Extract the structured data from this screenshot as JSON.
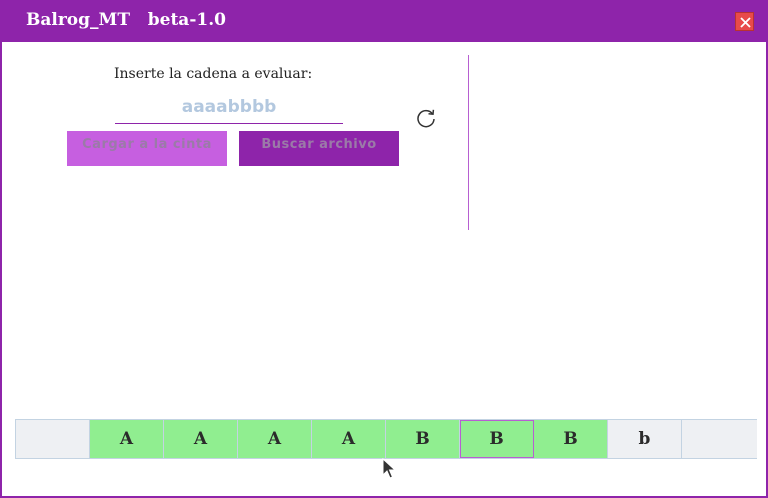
{
  "window": {
    "title": "Balrog_MT   beta-1.0",
    "accent_color": "#8e24aa",
    "close_icon": "close-icon"
  },
  "input_panel": {
    "prompt": "Inserte la cadena a evaluar:",
    "input_value": "aaaabbbb",
    "reload_icon": "reload-icon",
    "load_button_label": "Cargar a la cinta",
    "browse_button_label": "Buscar archivo"
  },
  "tape": {
    "cells": [
      {
        "symbol": "",
        "state": "blank"
      },
      {
        "symbol": "A",
        "state": "processed"
      },
      {
        "symbol": "A",
        "state": "processed"
      },
      {
        "symbol": "A",
        "state": "processed"
      },
      {
        "symbol": "A",
        "state": "processed"
      },
      {
        "symbol": "B",
        "state": "processed"
      },
      {
        "symbol": "B",
        "state": "processed",
        "head": true
      },
      {
        "symbol": "B",
        "state": "processed"
      },
      {
        "symbol": "b",
        "state": "pending"
      },
      {
        "symbol": "",
        "state": "blank"
      }
    ],
    "processed_color": "#90ee90",
    "blank_color": "#eef0f3"
  }
}
